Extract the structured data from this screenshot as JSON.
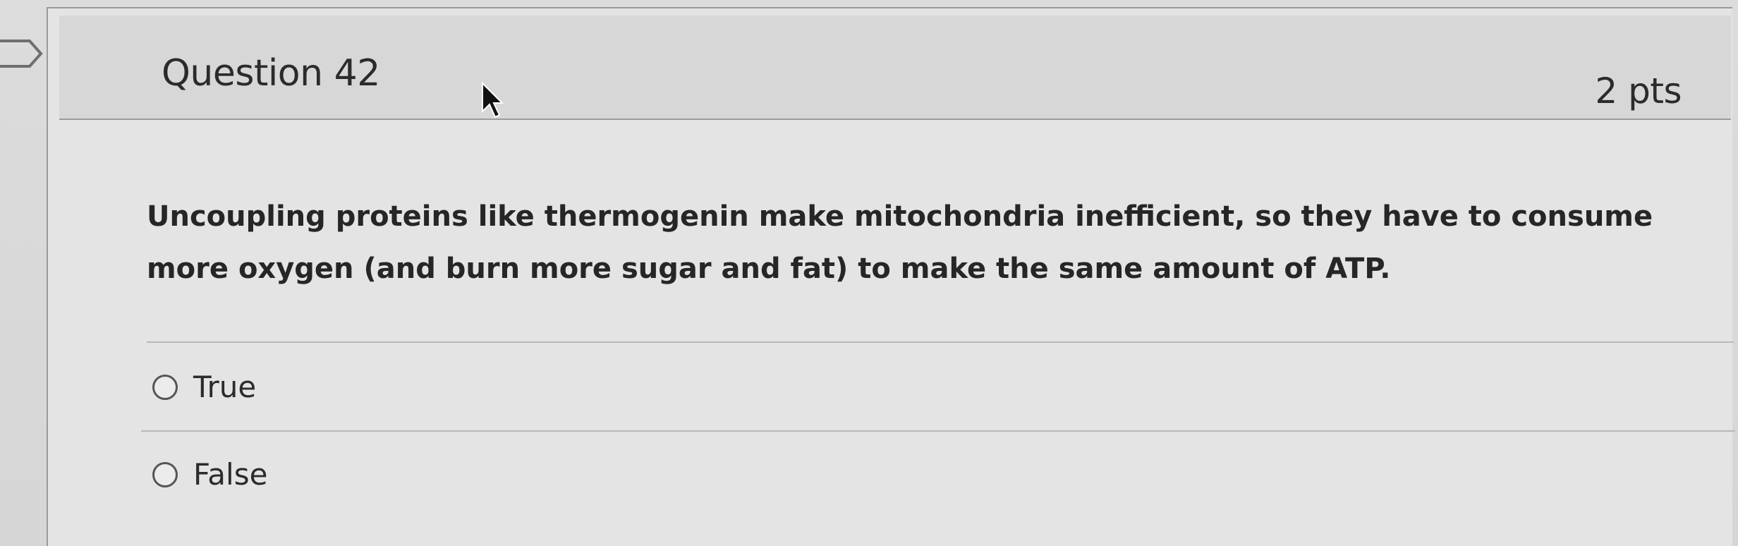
{
  "question": {
    "title": "Question 42",
    "points": "2 pts",
    "text": "Uncoupling proteins like thermogenin make mitochondria inefficient, so they have to consume more oxygen (and burn more sugar and fat) to make the same amount of ATP.",
    "answers": [
      {
        "label": "True",
        "selected": false
      },
      {
        "label": "False",
        "selected": false
      }
    ]
  },
  "icons": {
    "bookmark": "bookmark-flag-icon",
    "cursor": "mouse-pointer-icon",
    "radio": "radio-button-icon"
  }
}
